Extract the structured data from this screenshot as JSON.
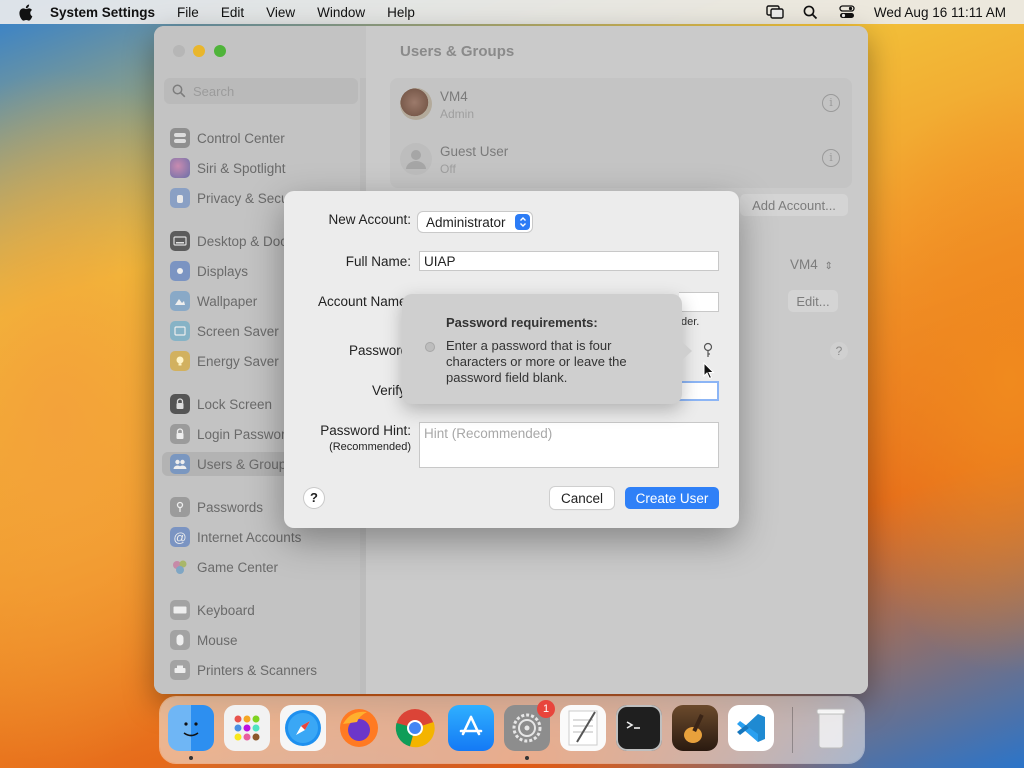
{
  "menubar": {
    "app_name": "System Settings",
    "menus": [
      "File",
      "Edit",
      "View",
      "Window",
      "Help"
    ],
    "clock": "Wed Aug 16  11:11 AM"
  },
  "window": {
    "title": "Users & Groups",
    "search_placeholder": "Search",
    "sidebar": {
      "items": [
        {
          "label": "Control Center",
          "icon": "control-center-icon"
        },
        {
          "label": "Siri & Spotlight",
          "icon": "siri-icon"
        },
        {
          "label": "Privacy & Secu",
          "icon": "hand-icon"
        },
        {
          "label": "Desktop & Doc",
          "icon": "desktop-icon"
        },
        {
          "label": "Displays",
          "icon": "sun-icon"
        },
        {
          "label": "Wallpaper",
          "icon": "wallpaper-icon"
        },
        {
          "label": "Screen Saver",
          "icon": "screen-saver-icon"
        },
        {
          "label": "Energy Saver",
          "icon": "bulb-icon"
        },
        {
          "label": "Lock Screen",
          "icon": "lock-icon"
        },
        {
          "label": "Login Passwor",
          "icon": "lock-icon"
        },
        {
          "label": "Users & Group",
          "icon": "users-icon",
          "selected": true
        },
        {
          "label": "Passwords",
          "icon": "key-icon"
        },
        {
          "label": "Internet Accounts",
          "icon": "at-icon"
        },
        {
          "label": "Game Center",
          "icon": "game-center-icon"
        },
        {
          "label": "Keyboard",
          "icon": "keyboard-icon"
        },
        {
          "label": "Mouse",
          "icon": "mouse-icon"
        },
        {
          "label": "Printers & Scanners",
          "icon": "printer-icon"
        }
      ]
    },
    "users": [
      {
        "name": "VM4",
        "role": "Admin"
      },
      {
        "name": "Guest User",
        "role": "Off"
      }
    ],
    "add_account_label": "Add Account...",
    "auto_login_value": "VM4",
    "edit_label": "Edit...",
    "help_label": "?"
  },
  "dialog": {
    "new_account_label": "New Account:",
    "new_account_value": "Administrator",
    "full_name_label": "Full Name:",
    "full_name_value": "UIAP",
    "account_name_label": "Account Name",
    "account_name_hint_tail": "der.",
    "password_label": "Password",
    "verify_label": "Verify",
    "hint_label": "Password Hint:",
    "hint_sublabel": "(Recommended)",
    "hint_placeholder": "Hint (Recommended)",
    "help_label": "?",
    "cancel_label": "Cancel",
    "create_label": "Create User"
  },
  "tooltip": {
    "title": "Password requirements:",
    "body": "Enter a password that is four characters or more or leave the password field blank."
  },
  "dock": {
    "apps": [
      "Finder",
      "Launchpad",
      "Safari",
      "Firefox",
      "Chrome",
      "App Store",
      "System Settings",
      "TextEdit",
      "Terminal",
      "GarageBand",
      "Visual Studio Code",
      "Trash"
    ],
    "settings_badge": "1"
  },
  "colors": {
    "accent": "#2f80f7",
    "badge": "#e8453c"
  }
}
